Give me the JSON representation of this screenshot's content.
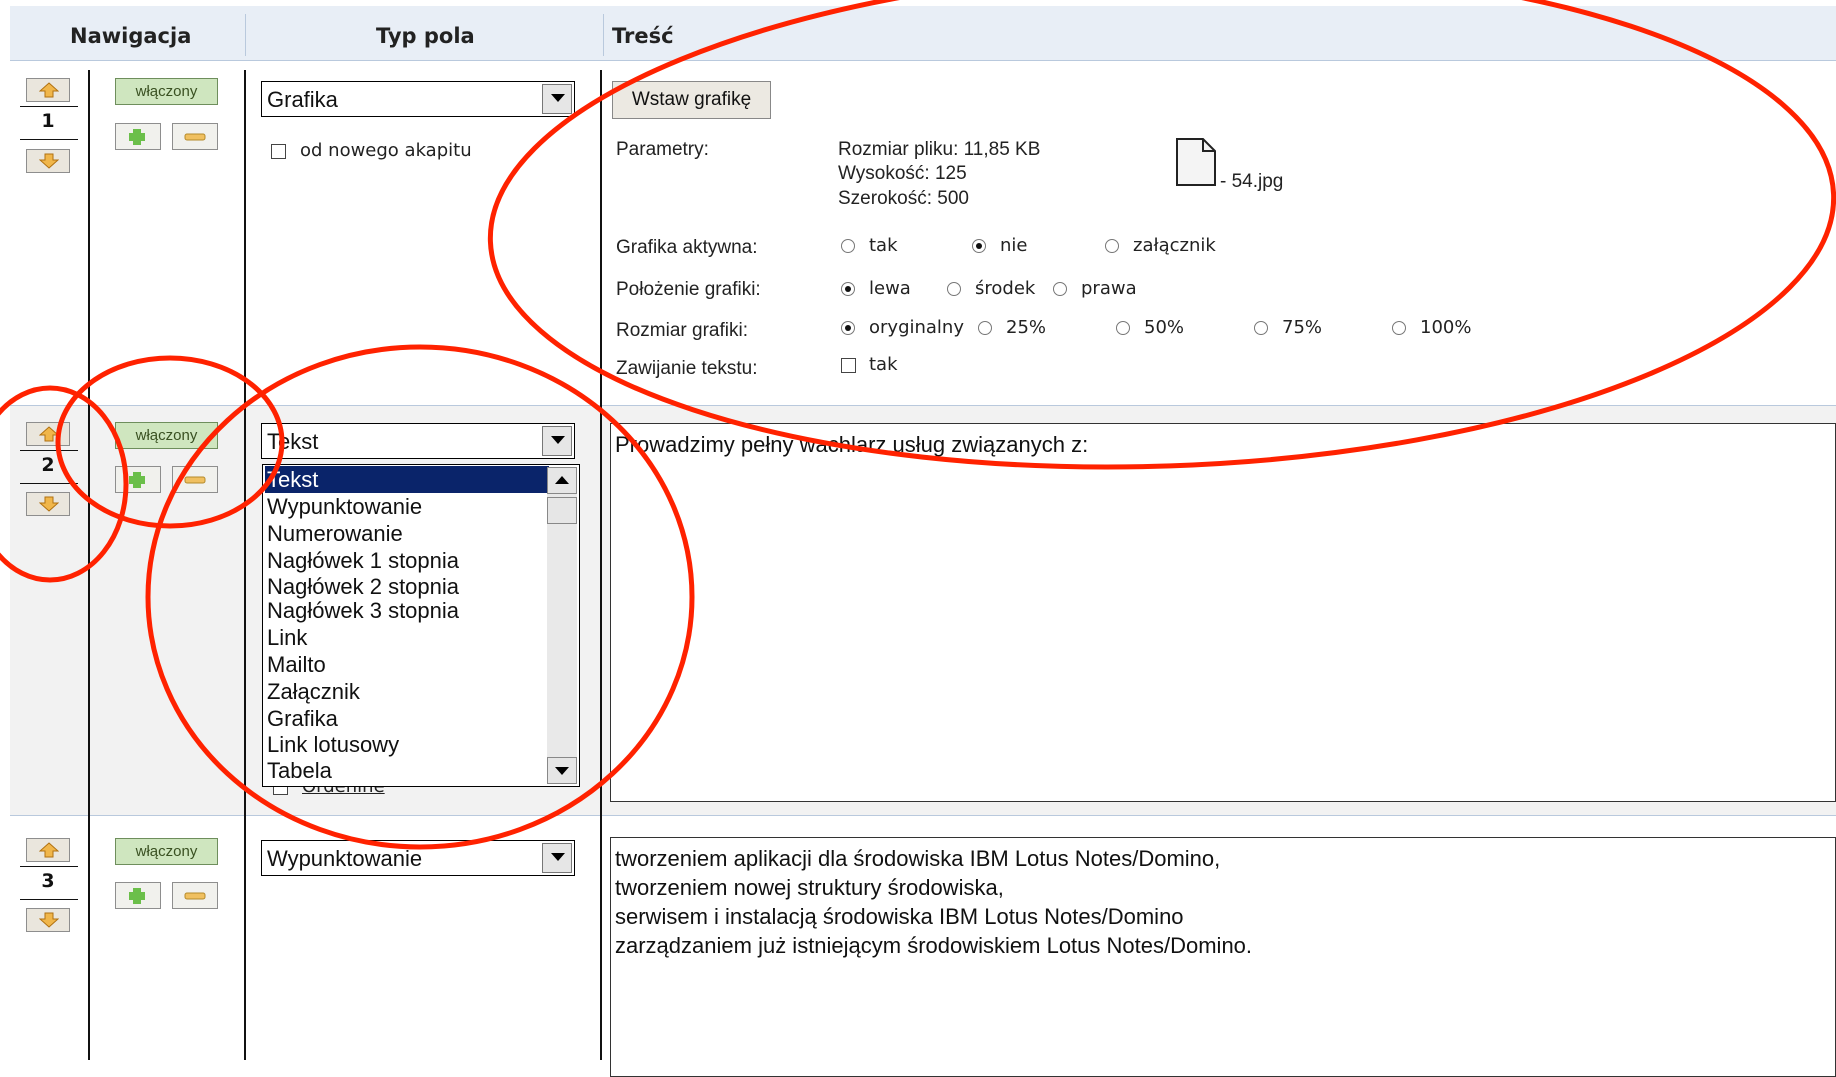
{
  "header": {
    "col_nav": "Nawigacja",
    "col_type": "Typ pola",
    "col_content": "Treść"
  },
  "rows": [
    {
      "number": "1",
      "status_label": "włączony",
      "field_type": "Grafika",
      "new_paragraph_label": "od nowego akapitu",
      "insert_button": "Wstaw grafikę",
      "params_label": "Parametry:",
      "file_size": "Rozmiar pliku: 11,85 KB",
      "height": "Wysokość: 125",
      "width": "Szerokość: 500",
      "file_name": "- 54.jpg",
      "active_label": "Grafika aktywna:",
      "active_options": [
        "tak",
        "nie",
        "załącznik"
      ],
      "active_selected": "nie",
      "position_label": "Położenie grafiki:",
      "position_options": [
        "lewa",
        "środek",
        "prawa"
      ],
      "position_selected": "lewa",
      "size_label": "Rozmiar grafiki:",
      "size_options": [
        "oryginalny",
        "25%",
        "50%",
        "75%",
        "100%"
      ],
      "size_selected": "oryginalny",
      "wrap_label": "Zawijanie tekstu:",
      "wrap_option": "tak"
    },
    {
      "number": "2",
      "status_label": "włączony",
      "field_type": "Tekst",
      "hidden_checkbox_label": "Ordenine",
      "content_text": "Prowadzimy pełny wachlarz usług związanych z:",
      "dropdown_options": [
        "Tekst",
        "Wypunktowanie",
        "Numerowanie",
        "Nagłówek 1 stopnia",
        "Nagłówek 2 stopnia",
        "Nagłówek 3 stopnia",
        "Link",
        "Mailto",
        "Załącznik",
        "Grafika",
        "Link lotusowy",
        "Tabela"
      ],
      "dropdown_selected": "Tekst"
    },
    {
      "number": "3",
      "status_label": "włączony",
      "field_type": "Wypunktowanie",
      "content_lines": [
        "tworzeniem aplikacji dla środowiska IBM Lotus Notes/Domino,",
        "tworzeniem nowej struktury środowiska,",
        "serwisem i instalacją środowiska IBM Lotus Notes/Domino",
        "zarządzaniem już istniejącym środowiskiem Lotus Notes/Domino."
      ]
    }
  ],
  "annotation_color": "#ff2200"
}
